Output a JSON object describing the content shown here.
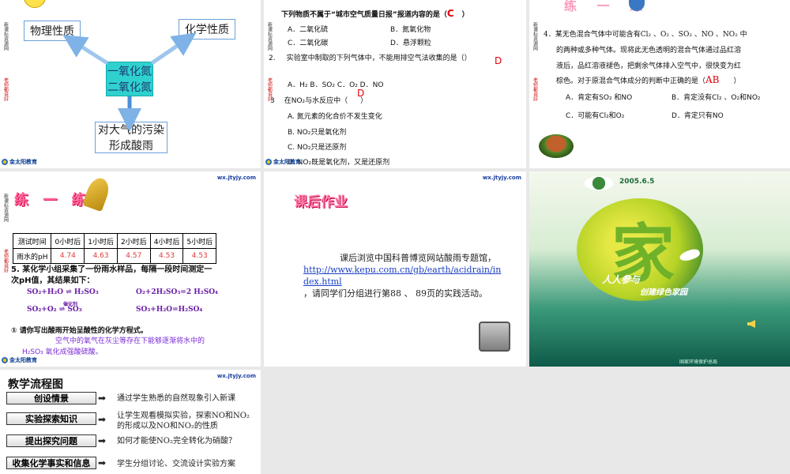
{
  "slide1": {
    "box_physical": "物理性质",
    "box_chemical": "化学性质",
    "box_center_line1": "一氧化氮",
    "box_center_line2": "二氧化氮",
    "box_pollution_line1": "对大气的污染",
    "box_pollution_line2": "形成酸雨",
    "logo": "金太阳教育"
  },
  "slide2": {
    "q1": "下列物质不属于“城市空气质量日报”报道内容的是（",
    "q1_close": "）",
    "q1_answer": "C",
    "q1_a": "A．二氧化硫",
    "q1_b": "B．氮氧化物",
    "q1_c": "C．二氧化碳",
    "q1_d": "D．悬浮颗粒",
    "q2_num": "2.",
    "q2": "实验室中制取的下列气体中，不能用排空气法收集的是（",
    "q2_close": "）",
    "q2_answer": "D",
    "q2_opts": "A．H₂      B．SO₂      C．O₂      D．NO",
    "q3_num": "3",
    "q3": "在NO₂与水反应中（",
    "q3_close": "）",
    "q3_answer": "D",
    "q3_a": "A.    氮元素的化合价不发生变化",
    "q3_b": "B.    NO₂只是氧化剂",
    "q3_c": "C.    NO₂只是还原剂",
    "q3_d": "D.  NO₂既是氧化剂，又是还原剂",
    "logo": "金太阳教育"
  },
  "slide3": {
    "banner": "练 一 练",
    "q4_line1": "4．某无色混合气体中可能含有Cl₂ 、O₂ 、SO₂ 、NO 、NO₂ 中",
    "q4_line2": "的两种或多种气体。现将此无色透明的混合气体通过品红溶",
    "q4_line3": "液后，品红溶液褪色，把剩余气体排入空气中，很快变为红",
    "q4_line4": "棕色。对于原混合气体成分的判断中正确的是（",
    "q4_close": "）",
    "q4_answer": "AB",
    "opt_a": "A．肯定有SO₂ 和NO",
    "opt_b": "B．肯定没有Cl₂ 、O₂和NO₂",
    "opt_c": "C．可能有Cl₂和O₂",
    "opt_d": "D．肯定只有NO"
  },
  "slide4": {
    "site": "wx.jtyjy.com",
    "banner": "练 一 练",
    "table_headers": [
      "测试时间",
      "0小时后",
      "1小时后",
      "2小时后",
      "4小时后",
      "5小时后"
    ],
    "row_label": "雨水的pH",
    "row_values": [
      "4.74",
      "4.63",
      "4.57",
      "4.53",
      "4.53"
    ],
    "q5_line1": "5.   某化学小组采集了一份雨水样品，每隔一段时间测定一",
    "q5_line2": "次pH值，其结果如下：",
    "eq1": "SO₂+H₂O ⇌ H₂SO₃",
    "eq2": "O₂+2H₂SO₃=2 H₂SO₄",
    "eq3": "SO₂+O₂ ⇌ SO₃",
    "eq3_cond": "催化剂",
    "eq4": "SO₃+H₂O=H₂SO₄",
    "q_sub": "① 请你写出酸雨开始呈酸性的化学方程式。",
    "explain1": "空气中的氧气在灰尘等存在下能够逐渐将水中的",
    "explain2": "H₂SO₃ 氧化成强酸硫酸。",
    "logo": "金太阳教育"
  },
  "slide5": {
    "site": "wx.jtyjy.com",
    "banner": "课后作业",
    "body1": "课后浏览中国科普博览网站酸雨专题馆，",
    "link": "http://www.kepu.com.cn/gb/earth/acidrain/index.html",
    "body2": "，请同学们分组进行第88 、 89页的实践活动。"
  },
  "slide6": {
    "date": "2005.6.5",
    "big_char": "家",
    "slogan1": "人人参与",
    "slogan2": "创建绿色家园",
    "bottom": "国家环境保护总局"
  },
  "slide7": {
    "site": "wx.jtyjy.com",
    "title": "教学流程图",
    "steps": [
      {
        "label": "创设情景",
        "desc": "通过学生熟悉的自然现象引入新课"
      },
      {
        "label": "实验探索知识",
        "desc": "让学生观看模拟实验，探索NO和NO₂的形成以及NO和NO₂的性质"
      },
      {
        "label": "提出探究问题",
        "desc": "如何才能使NO₂完全转化为硝酸？"
      },
      {
        "label": "收集化学事实和信息",
        "desc": "学生分组讨论、交流设计实验方案"
      }
    ]
  },
  "side_strip": {
    "top": "新课标资源网",
    "bottom": "老师都说好"
  }
}
